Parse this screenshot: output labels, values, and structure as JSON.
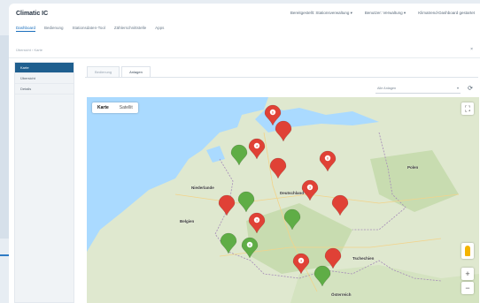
{
  "app": {
    "title": "Climatic IC"
  },
  "top_actions": [
    "Bereitgestellt: Stationsverwaltung ▾",
    "Benutzer: Verwaltung ▾",
    "Klimatrend-Dashboard gestartet"
  ],
  "nav": [
    "Dashboard",
    "Bedienung",
    "Stationsdaten-Tool",
    "Zählerschnittstelle",
    "Apps"
  ],
  "breadcrumb": "Übersicht › Karte",
  "close_icon_glyph": "×",
  "sidebar": [
    "Karte",
    "Übersicht",
    "Details"
  ],
  "tabs": [
    "Bedienung",
    "Anlagen"
  ],
  "filter": {
    "label": "Alle Anlagen",
    "caret": "▾"
  },
  "refresh_icon": "⟳",
  "map": {
    "map_type": [
      "Karte",
      "Satellit"
    ],
    "fullscreen_icon": "⛶",
    "zoom_in": "+",
    "zoom_out": "−",
    "cities": [
      "Polen",
      "Niederlande",
      "Deutschland",
      "Belgien",
      "Tschechien",
      "Österreich"
    ],
    "colors": {
      "red": "#e04136",
      "green": "#5fad46"
    },
    "markers": [
      {
        "color": "red",
        "badge": "6"
      },
      {
        "color": "red",
        "badge": ""
      },
      {
        "color": "green",
        "badge": ""
      },
      {
        "color": "red",
        "badge": "4"
      },
      {
        "color": "red",
        "badge": ""
      },
      {
        "color": "red",
        "badge": "6"
      },
      {
        "color": "red",
        "badge": "3"
      },
      {
        "color": "green",
        "badge": ""
      },
      {
        "color": "red",
        "badge": ""
      },
      {
        "color": "red",
        "badge": ""
      },
      {
        "color": "green",
        "badge": ""
      },
      {
        "color": "red",
        "badge": "3"
      },
      {
        "color": "green",
        "badge": ""
      },
      {
        "color": "green",
        "badge": "6"
      },
      {
        "color": "red",
        "badge": "3"
      },
      {
        "color": "red",
        "badge": ""
      },
      {
        "color": "green",
        "badge": ""
      }
    ]
  }
}
